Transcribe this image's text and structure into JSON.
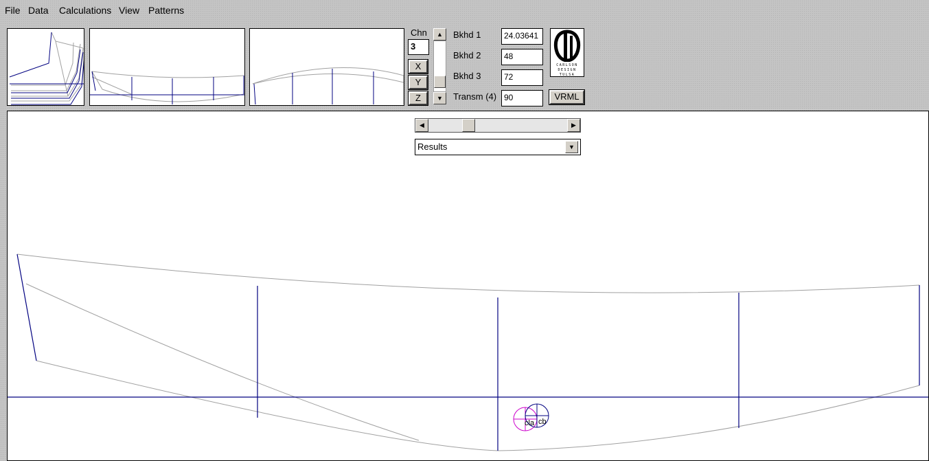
{
  "menu": [
    "File",
    "Data",
    "Calculations",
    "View",
    "Patterns"
  ],
  "chine": {
    "label": "Chn",
    "value": "3"
  },
  "axis_buttons": [
    "X",
    "Y",
    "Z"
  ],
  "bulkheads": [
    {
      "label": "Bkhd 1",
      "value": "24.03641"
    },
    {
      "label": "Bkhd 2",
      "value": "48"
    },
    {
      "label": "Bkhd 3",
      "value": "72"
    },
    {
      "label": "Transm (4)",
      "value": "90"
    }
  ],
  "vrml_label": "VRML",
  "logo": {
    "lines": [
      "CARLSON",
      "DESIGN",
      "TULSA"
    ]
  },
  "view_select": {
    "selected": "Results"
  },
  "annotations": {
    "cla": "cla",
    "cb": "cb"
  },
  "icons": {
    "scroll_up": "scroll-up-arrow-icon",
    "scroll_down": "scroll-down-arrow-icon",
    "scroll_left": "scroll-left-arrow-icon",
    "scroll_right": "scroll-right-arrow-icon",
    "dropdown": "chevron-down-icon"
  },
  "colors": {
    "section_line": "#000080",
    "hull_line": "#a0a0a0",
    "cla_marker": "#cc00cc",
    "cb_marker": "#000080"
  },
  "horizontal_slider_value": 0.27
}
